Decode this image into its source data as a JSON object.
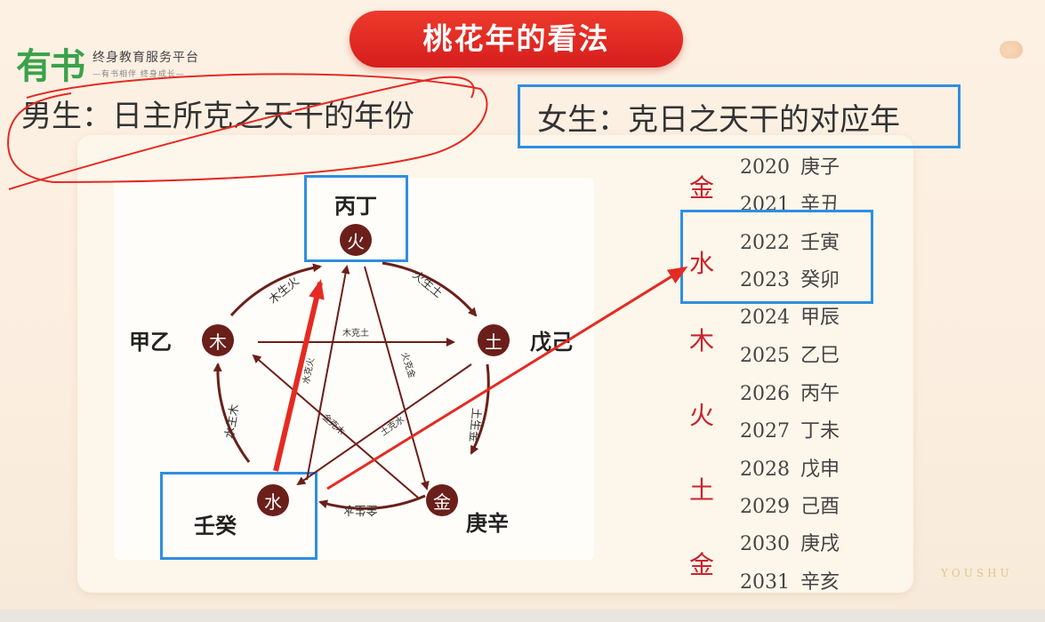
{
  "logo": {
    "mark": "有书",
    "title": "终身教育服务平台",
    "slogan": "—有书相伴 终身成长—"
  },
  "title": "桃花年的看法",
  "male": {
    "text": "男生：日主所克之天干的年份"
  },
  "female": {
    "text": "女生：克日之天干的对应年"
  },
  "wuxing": {
    "nodes": [
      {
        "element": "火",
        "stems": "丙丁"
      },
      {
        "element": "土",
        "stems": "戊己"
      },
      {
        "element": "金",
        "stems": "庚辛"
      },
      {
        "element": "水",
        "stems": "壬癸"
      },
      {
        "element": "木",
        "stems": "甲乙"
      }
    ],
    "generating_labels": [
      "木生火",
      "火生土",
      "土生金",
      "金生水",
      "水生木"
    ],
    "controlling_labels": [
      "木克土",
      "火克金",
      "土克水",
      "金克木",
      "水克火"
    ]
  },
  "years": [
    {
      "year": "2020",
      "ganzhi": "庚子"
    },
    {
      "year": "2021",
      "ganzhi": "辛丑"
    },
    {
      "year": "2022",
      "ganzhi": "壬寅"
    },
    {
      "year": "2023",
      "ganzhi": "癸卯"
    },
    {
      "year": "2024",
      "ganzhi": "甲辰"
    },
    {
      "year": "2025",
      "ganzhi": "乙巳"
    },
    {
      "year": "2026",
      "ganzhi": "丙午"
    },
    {
      "year": "2027",
      "ganzhi": "丁未"
    },
    {
      "year": "2028",
      "ganzhi": "戊申"
    },
    {
      "year": "2029",
      "ganzhi": "己酉"
    },
    {
      "year": "2030",
      "ganzhi": "庚戌"
    },
    {
      "year": "2031",
      "ganzhi": "辛亥"
    }
  ],
  "year_elements": [
    "金",
    "水",
    "木",
    "火",
    "土",
    "金"
  ],
  "watermark": "YOUSHU",
  "colors": {
    "title_red": "#e02a22",
    "node_brown": "#6b1f1a",
    "highlight_blue": "#2f8ee0",
    "annotation_red": "#e52a22",
    "element_red": "#c9242d"
  }
}
